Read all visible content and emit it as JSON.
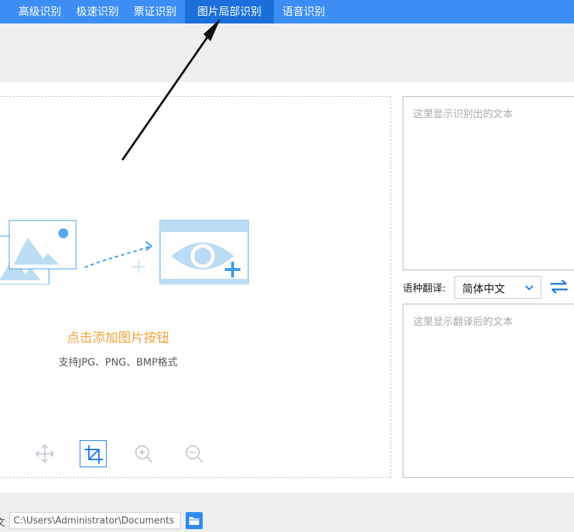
{
  "nav": {
    "tabs": [
      {
        "label": "高级识别"
      },
      {
        "label": "极速识别"
      },
      {
        "label": "票证识别"
      },
      {
        "label": "图片局部识别",
        "active": true
      },
      {
        "label": "语音识别"
      }
    ]
  },
  "upload": {
    "title": "点击添加图片按钮",
    "hint": "支持JPG、PNG、BMP格式"
  },
  "tools": [
    "move-icon",
    "crop-icon",
    "zoom-in-icon",
    "zoom-out-icon"
  ],
  "output": {
    "recognized_placeholder": "这里显示识别出的文本",
    "translated_placeholder": "这里显示翻译后的文本"
  },
  "translate": {
    "label": "语种翻译:",
    "selected": "简体中文"
  },
  "save": {
    "label": "文",
    "path": "C:\\Users\\Administrator\\Documents"
  },
  "colors": {
    "nav_bg": "#3c8ef5",
    "nav_active": "#1a6fdb",
    "accent": "#2d8cf0",
    "upload_title": "#f0a33a"
  }
}
